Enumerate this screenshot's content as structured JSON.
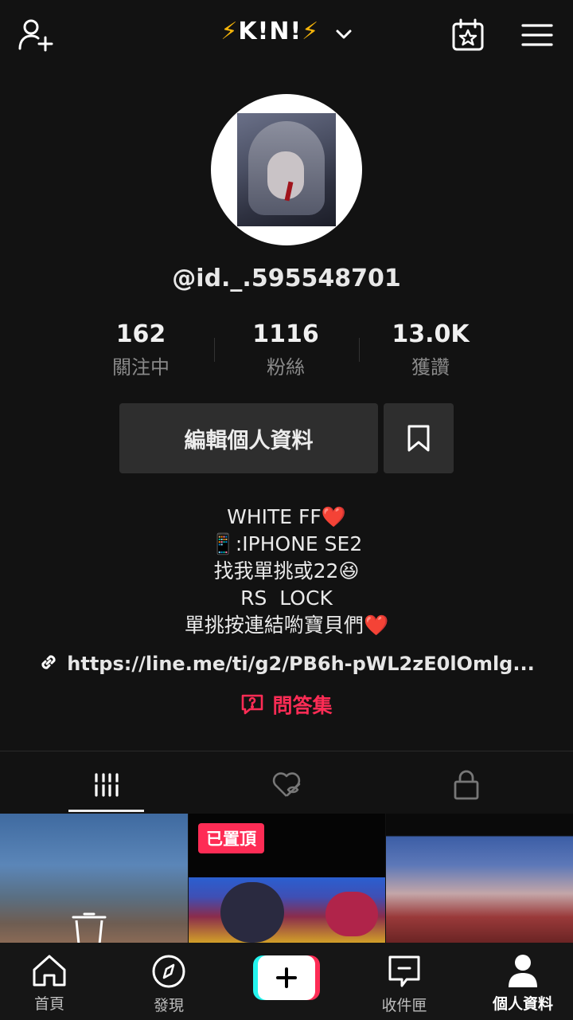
{
  "header": {
    "title_prefix": "⚡",
    "title": "K!N!",
    "title_suffix": "⚡",
    "icons": [
      "add-user-icon",
      "chevron-down-icon",
      "calendar-star-icon",
      "menu-icon"
    ]
  },
  "profile": {
    "username": "@id._.595548701",
    "stats": [
      {
        "value": "162",
        "label": "關注中"
      },
      {
        "value": "1116",
        "label": "粉絲"
      },
      {
        "value": "13.0K",
        "label": "獲讚"
      }
    ],
    "edit_button": "編輯個人資料",
    "bio_lines": [
      {
        "text": "WHITE FF",
        "emoji": "❤️"
      },
      {
        "prefix_emoji": "📱",
        "text": ":IPHONE SE2"
      },
      {
        "text": "找我單挑或22",
        "emoji": "😆"
      },
      {
        "text": "RS  LOCK"
      },
      {
        "text": "單挑按連結喲寶貝們",
        "emoji": "❤️"
      }
    ],
    "link": "https://line.me/ti/g2/PB6h-pWL2zE0lOmlg...",
    "qa_label": "問答集"
  },
  "tabs": [
    "videos-grid-icon",
    "liked-hidden-icon",
    "private-lock-icon"
  ],
  "videos": [
    {
      "pinned": false
    },
    {
      "pinned": true,
      "badge": "已置頂"
    },
    {
      "pinned": false
    }
  ],
  "bottom_nav": [
    {
      "label": "首頁",
      "icon": "home-icon"
    },
    {
      "label": "發現",
      "icon": "compass-icon"
    },
    {
      "label": "",
      "icon": "plus-icon"
    },
    {
      "label": "收件匣",
      "icon": "inbox-icon"
    },
    {
      "label": "個人資料",
      "icon": "profile-icon"
    }
  ],
  "colors": {
    "background": "#121212",
    "accent": "#fe2c55",
    "accent_alt": "#25f4ee",
    "bolt": "#f5b40a"
  }
}
